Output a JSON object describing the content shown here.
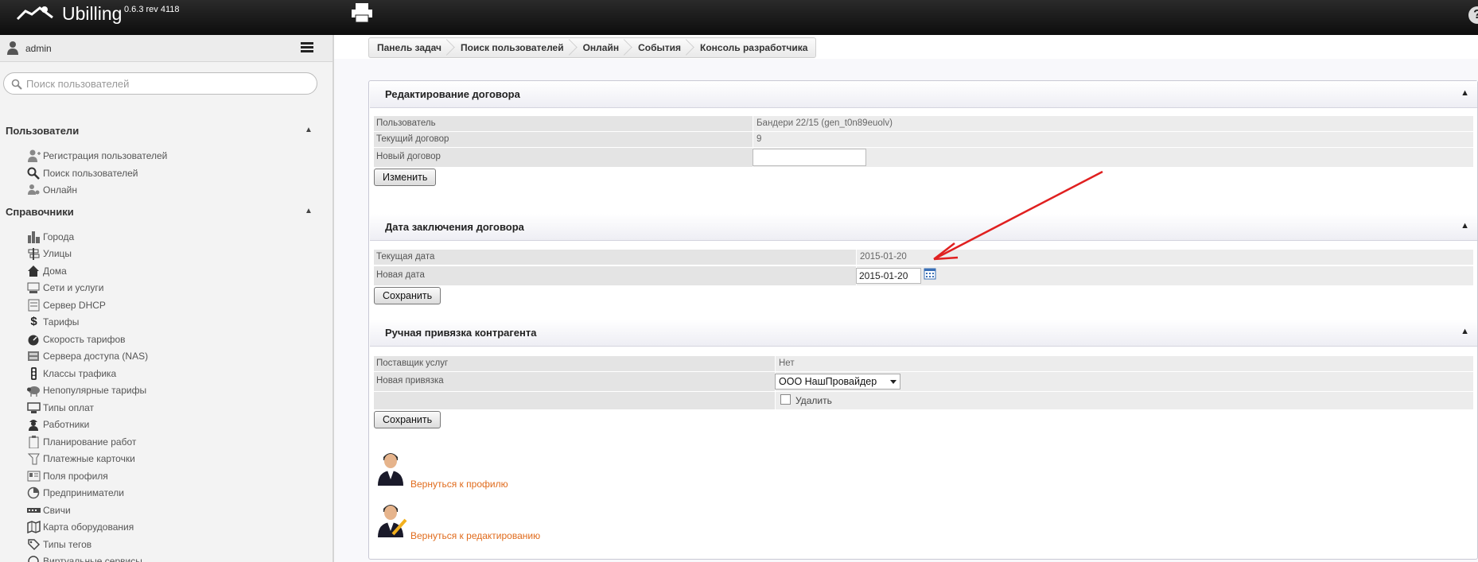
{
  "header": {
    "brand": "Ubilling",
    "version": "0.6.3 rev 4118"
  },
  "sidebar": {
    "user": "admin",
    "search_placeholder": "Поиск пользователей",
    "sections": [
      {
        "title": "Пользователи",
        "items": [
          {
            "label": "Регистрация пользователей",
            "icon": "user-add-icon"
          },
          {
            "label": "Поиск пользователей",
            "icon": "magnifier-icon"
          },
          {
            "label": "Онлайн",
            "icon": "users-online-icon"
          }
        ]
      },
      {
        "title": "Справочники",
        "items": [
          {
            "label": "Города",
            "icon": "city-icon"
          },
          {
            "label": "Улицы",
            "icon": "signpost-icon"
          },
          {
            "label": "Дома",
            "icon": "house-icon"
          },
          {
            "label": "Сети и услуги",
            "icon": "network-icon"
          },
          {
            "label": "Сервер DHCP",
            "icon": "server-icon"
          },
          {
            "label": "Тарифы",
            "icon": "dollar-icon"
          },
          {
            "label": "Скорость тарифов",
            "icon": "speedometer-icon"
          },
          {
            "label": "Сервера доступа (NAS)",
            "icon": "nas-icon"
          },
          {
            "label": "Классы трафика",
            "icon": "traffic-light-icon"
          },
          {
            "label": "Непопулярные тарифы",
            "icon": "sheep-icon"
          },
          {
            "label": "Типы оплат",
            "icon": "payment-terminal-icon"
          },
          {
            "label": "Работники",
            "icon": "worker-icon"
          },
          {
            "label": "Планирование работ",
            "icon": "clipboard-icon"
          },
          {
            "label": "Платежные карточки",
            "icon": "card-icon"
          },
          {
            "label": "Поля профиля",
            "icon": "profile-fields-icon"
          },
          {
            "label": "Предприниматели",
            "icon": "pie-icon"
          },
          {
            "label": "Свичи",
            "icon": "switch-icon"
          },
          {
            "label": "Карта оборудования",
            "icon": "map-icon"
          },
          {
            "label": "Типы тегов",
            "icon": "tag-icon"
          },
          {
            "label": "Виртуальные сервисы",
            "icon": "virtual-services-icon"
          }
        ]
      }
    ]
  },
  "breadcrumb": [
    "Панель задач",
    "Поиск пользователей",
    "Онлайн",
    "События",
    "Консоль разработчика"
  ],
  "panels": {
    "contract": {
      "title": "Редактирование договора",
      "rows": [
        {
          "label": "Пользователь",
          "value": "Бандери 22/15 (gen_t0n89euolv)"
        },
        {
          "label": "Текущий договор",
          "value": "9"
        },
        {
          "label": "Новый договор",
          "value": ""
        }
      ],
      "button": "Изменить"
    },
    "date": {
      "title": "Дата заключения договора",
      "rows": [
        {
          "label": "Текущая дата",
          "value": "2015-01-20"
        },
        {
          "label": "Новая дата",
          "value": "2015-01-20"
        }
      ],
      "button": "Сохранить"
    },
    "contragent": {
      "title": "Ручная привязка контрагента",
      "rows": [
        {
          "label": "Поставщик услуг",
          "value": "Нет"
        },
        {
          "label": "Новая привязка",
          "value": "ООО НашПровайдер"
        },
        {
          "label": "",
          "value": "Удалить"
        }
      ],
      "button": "Сохранить"
    }
  },
  "links": {
    "back_profile": "Вернуться к профилю",
    "back_edit": "Вернуться к редактированию"
  },
  "colors": {
    "link": "#e06b1c",
    "arrow": "#e02020"
  }
}
